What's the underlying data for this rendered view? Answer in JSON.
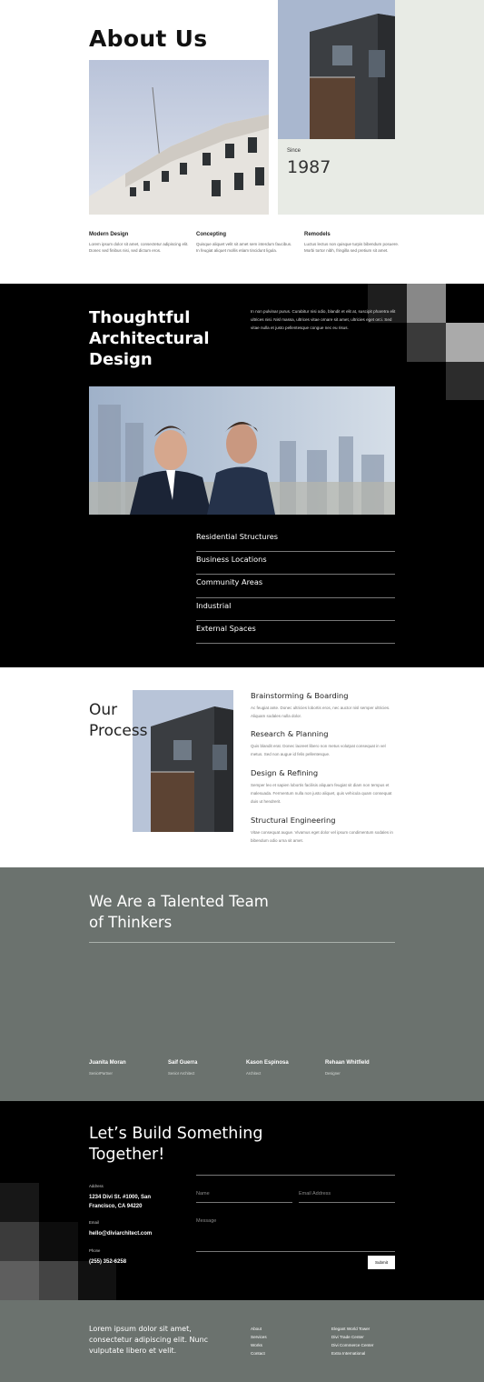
{
  "about": {
    "title": "About Us",
    "since_label": "Since",
    "since_year": "1987",
    "features": [
      {
        "title": "Modern Design",
        "text": "Lorem ipsum dolor sit amet, consectetur adipiscing elit. Donec sed finibus nisi, sed dictum eros."
      },
      {
        "title": "Concepting",
        "text": "Quisque aliquet velit sit amet sem interdum faucibus. In feugiat aliquet mollis etiam tincidunt ligula."
      },
      {
        "title": "Remodels",
        "text": "Luctus lectus non quisque turpis bibendum posuere. Morbi tortor nibh, fringilla sed pretium sit amet."
      }
    ]
  },
  "thoughtful": {
    "title": "Thoughtful Architectural Design",
    "text": "In non pulvinar purus. Curabitur nisi odio, blandit et elit at, suscipit pharetra elit ultrices nisi. Nisl massa, ultrices vitae ornare sit amet, ultricies eget orci. Sed vitae nulla et justo pellentesque congue nec eu risus.",
    "services": [
      "Residential Structures",
      "Business Locations",
      "Community Areas",
      "Industrial",
      "External Spaces"
    ]
  },
  "process": {
    "title_line1": "Our",
    "title_line2": "Process",
    "steps": [
      {
        "title": "Brainstorming & Boarding",
        "text": "Ac feugiat ante. Donec ultricies lobortis eros, nec auctor nisl semper ultricies. Aliquam sodales nulla dolor."
      },
      {
        "title": "Research & Planning",
        "text": "Quis blandit erat. Donec laoreet libero non metus volutpat consequat in vel metus. Sed non augue id felis pellentesque."
      },
      {
        "title": "Design & Refining",
        "text": "Semper leo et sapien lobortis facilisis aliquam feugiat sit diam non tempus et malesuada. Fermentum nulla non justo aliquet, quis vehicula quam consequat duis ut hendrerit."
      },
      {
        "title": "Structural Engineering",
        "text": "Vitae consequat augue. Vivamus eget dolor vel ipsum condimentum sodales in bibendum odio urna sit amet."
      }
    ]
  },
  "team": {
    "title_line1": "We Are a Talented Team",
    "title_line2": "of Thinkers",
    "members": [
      {
        "name": "Juanita Moran",
        "role": "SeniorPartner"
      },
      {
        "name": "Saif Guerra",
        "role": "Senior Architect"
      },
      {
        "name": "Kason Espinosa",
        "role": "Architect"
      },
      {
        "name": "Rehaan Whitfield",
        "role": "Designer"
      }
    ]
  },
  "contact": {
    "title_line1": "Let’s Build Something",
    "title_line2": "Together!",
    "address_label": "Address",
    "address_line1": "1234 Divi St. #1000, San",
    "address_line2": "Francisco, CA 94220",
    "email_label": "Email",
    "email_value": "hello@diviarchitect.com",
    "phone_label": "Phone",
    "phone_value": "(255) 352-6258",
    "form": {
      "name_placeholder": "Name",
      "email_placeholder": "Email Address",
      "message_placeholder": "Message",
      "submit_label": "Submit"
    }
  },
  "footer": {
    "text": "Lorem ipsum dolor sit amet, consectetur adipiscing elit. Nunc vulputate libero et velit.",
    "links": [
      "About",
      "Services",
      "Works",
      "Contact"
    ],
    "locations": [
      "Elegant World Tower",
      "Divi Trade Center",
      "Divi Commerce Center",
      "Extra International"
    ]
  },
  "colors": {
    "sage": "#e8ebe5",
    "gray_green": "#6b726e",
    "black": "#000000"
  }
}
